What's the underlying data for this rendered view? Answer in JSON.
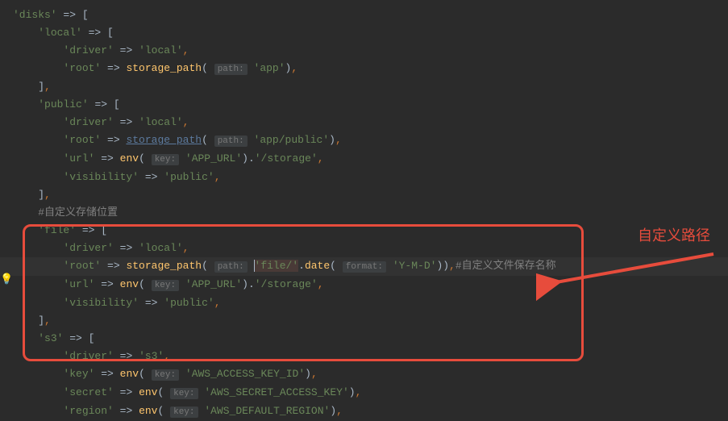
{
  "annotation": {
    "label": "自定义路径"
  },
  "lines": {
    "l1_key": "'disks'",
    "l1_bracket": "[",
    "l2_key": "'local'",
    "l2_bracket": "[",
    "l3_key": "'driver'",
    "l3_val": "'local'",
    "l4_key": "'root'",
    "l4_func": "storage_path",
    "l4_hint": "path:",
    "l4_val": "'app'",
    "l5_key": "'public'",
    "l5_bracket": "[",
    "l6_key": "'driver'",
    "l6_val": "'local'",
    "l7_key": "'root'",
    "l7_func": "storage_path",
    "l7_hint": "path:",
    "l7_val": "'app/public'",
    "l8_key": "'url'",
    "l8_func": "env",
    "l8_hint": "key:",
    "l8_val": "'APP_URL'",
    "l8_suffix": "'/storage'",
    "l9_key": "'visibility'",
    "l9_val": "'public'",
    "comment1": "#自定义存储位置",
    "l10_key": "'file'",
    "l10_bracket": "[",
    "l11_key": "'driver'",
    "l11_val": "'local'",
    "l12_key": "'root'",
    "l12_func": "storage_path",
    "l12_hint": "path:",
    "l12_val1": "'file/'",
    "l12_func2": "date",
    "l12_hint2": "format:",
    "l12_val2": "'Y-M-D'",
    "l12_comment": "#自定义文件保存名称",
    "l13_key": "'url'",
    "l13_func": "env",
    "l13_hint": "key:",
    "l13_val": "'APP_URL'",
    "l13_suffix": "'/storage'",
    "l14_key": "'visibility'",
    "l14_val": "'public'",
    "l15_key": "'s3'",
    "l15_bracket": "[",
    "l16_key": "'driver'",
    "l16_val": "'s3'",
    "l17_key": "'key'",
    "l17_func": "env",
    "l17_hint": "key:",
    "l17_val": "'AWS_ACCESS_KEY_ID'",
    "l18_key": "'secret'",
    "l18_func": "env",
    "l18_hint": "key:",
    "l18_val": "'AWS_SECRET_ACCESS_KEY'",
    "l19_key": "'region'",
    "l19_func": "env",
    "l19_hint": "key:",
    "l19_val": "'AWS_DEFAULT_REGION'"
  }
}
